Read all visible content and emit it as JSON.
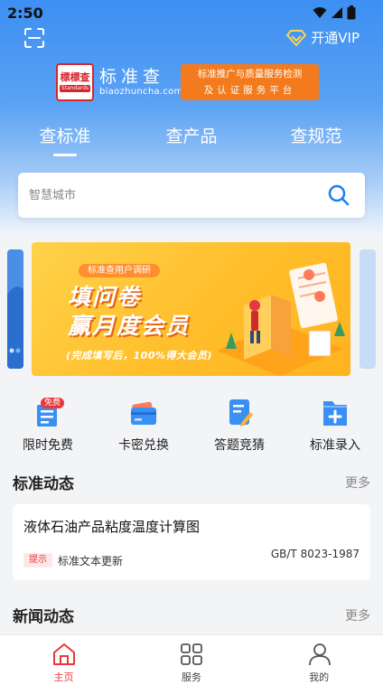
{
  "status_bar": {
    "time": "2:50"
  },
  "header": {
    "vip_label": "开通VIP"
  },
  "brand": {
    "logo_seal": "標標查",
    "logo_mini": "Standards",
    "name": "标准查",
    "domain": "biaozhuncha.com",
    "slogan_line1": "标准推广与质量服务检测",
    "slogan_line2": "及认证服务平台"
  },
  "tabs": [
    {
      "label": "查标准",
      "active": true
    },
    {
      "label": "查产品",
      "active": false
    },
    {
      "label": "查规范",
      "active": false
    }
  ],
  "search": {
    "placeholder": "智慧城市"
  },
  "banner": {
    "tag": "标准查用户调研",
    "title_line1": "填问卷",
    "title_line2": "赢月度会员",
    "subtitle": "(完成填写后，100%得大会员)"
  },
  "quick_menu": [
    {
      "label": "限时免费",
      "icon": "free-doc-icon",
      "badge": "免费"
    },
    {
      "label": "卡密兑换",
      "icon": "card-icon"
    },
    {
      "label": "答题竞猜",
      "icon": "quiz-edit-icon"
    },
    {
      "label": "标准录入",
      "icon": "folder-add-icon"
    }
  ],
  "standards_section": {
    "title": "标准动态",
    "more": "更多",
    "item": {
      "title": "液体石油产品粘度温度计算图",
      "tag": "提示",
      "type": "标准文本更新",
      "code": "GB/T 8023-1987"
    }
  },
  "news_section": {
    "title": "新闻动态",
    "more": "更多"
  },
  "bottom_nav": [
    {
      "label": "主页",
      "icon": "home-icon",
      "active": true
    },
    {
      "label": "服务",
      "icon": "grid-icon",
      "active": false
    },
    {
      "label": "我的",
      "icon": "user-icon",
      "active": false
    }
  ],
  "colors": {
    "primary_blue": "#3d8ff2",
    "accent_red": "#e8383d",
    "slogan_orange": "#f37b1d",
    "banner_yellow": "#ffc12e"
  }
}
